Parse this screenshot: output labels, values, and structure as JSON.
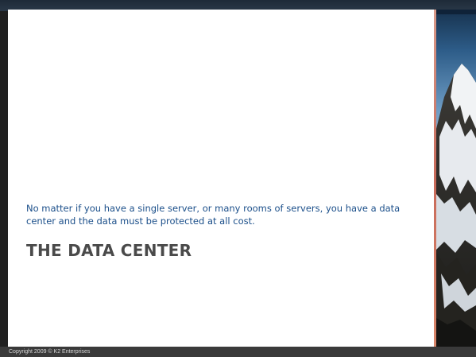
{
  "slide": {
    "subtitle": "No matter if you have a single server, or many rooms of servers, you have a data center and the data must be protected at all cost.",
    "title": "THE DATA CENTER",
    "footer": "Copyright 2009 © K2 Enterprises"
  },
  "images": {
    "side_photo": "snow-capped-mountain-photo"
  },
  "colors": {
    "subtitle_text": "#1b4f8a",
    "title_text": "#4a4a4a",
    "accent_divider": "#c86a5a",
    "frame_dark": "#202020"
  }
}
